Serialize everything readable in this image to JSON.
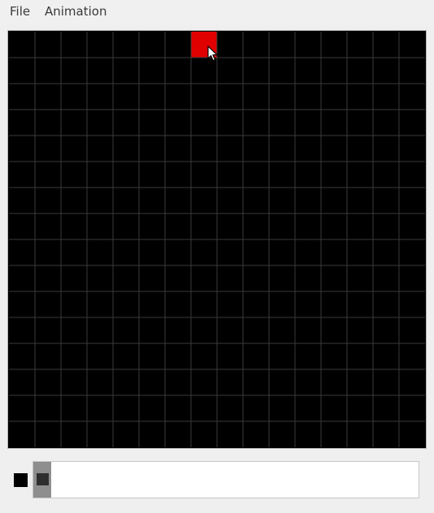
{
  "menu": {
    "items": [
      {
        "label": "File"
      },
      {
        "label": "Animation"
      }
    ]
  },
  "canvas": {
    "grid_columns": 16,
    "grid_rows": 16,
    "background_color": "#000000",
    "grid_line_color": "#3a3a3a",
    "filled_cells": [
      {
        "col": 7,
        "row": 0,
        "color": "#e00000"
      }
    ]
  },
  "cursor": {
    "icon": "arrow-pointer-icon"
  },
  "palette": {
    "active_color": "#000000"
  },
  "timeline": {
    "frames": [
      {
        "thumb_color": "#2e2e2e",
        "selected": true
      }
    ]
  }
}
